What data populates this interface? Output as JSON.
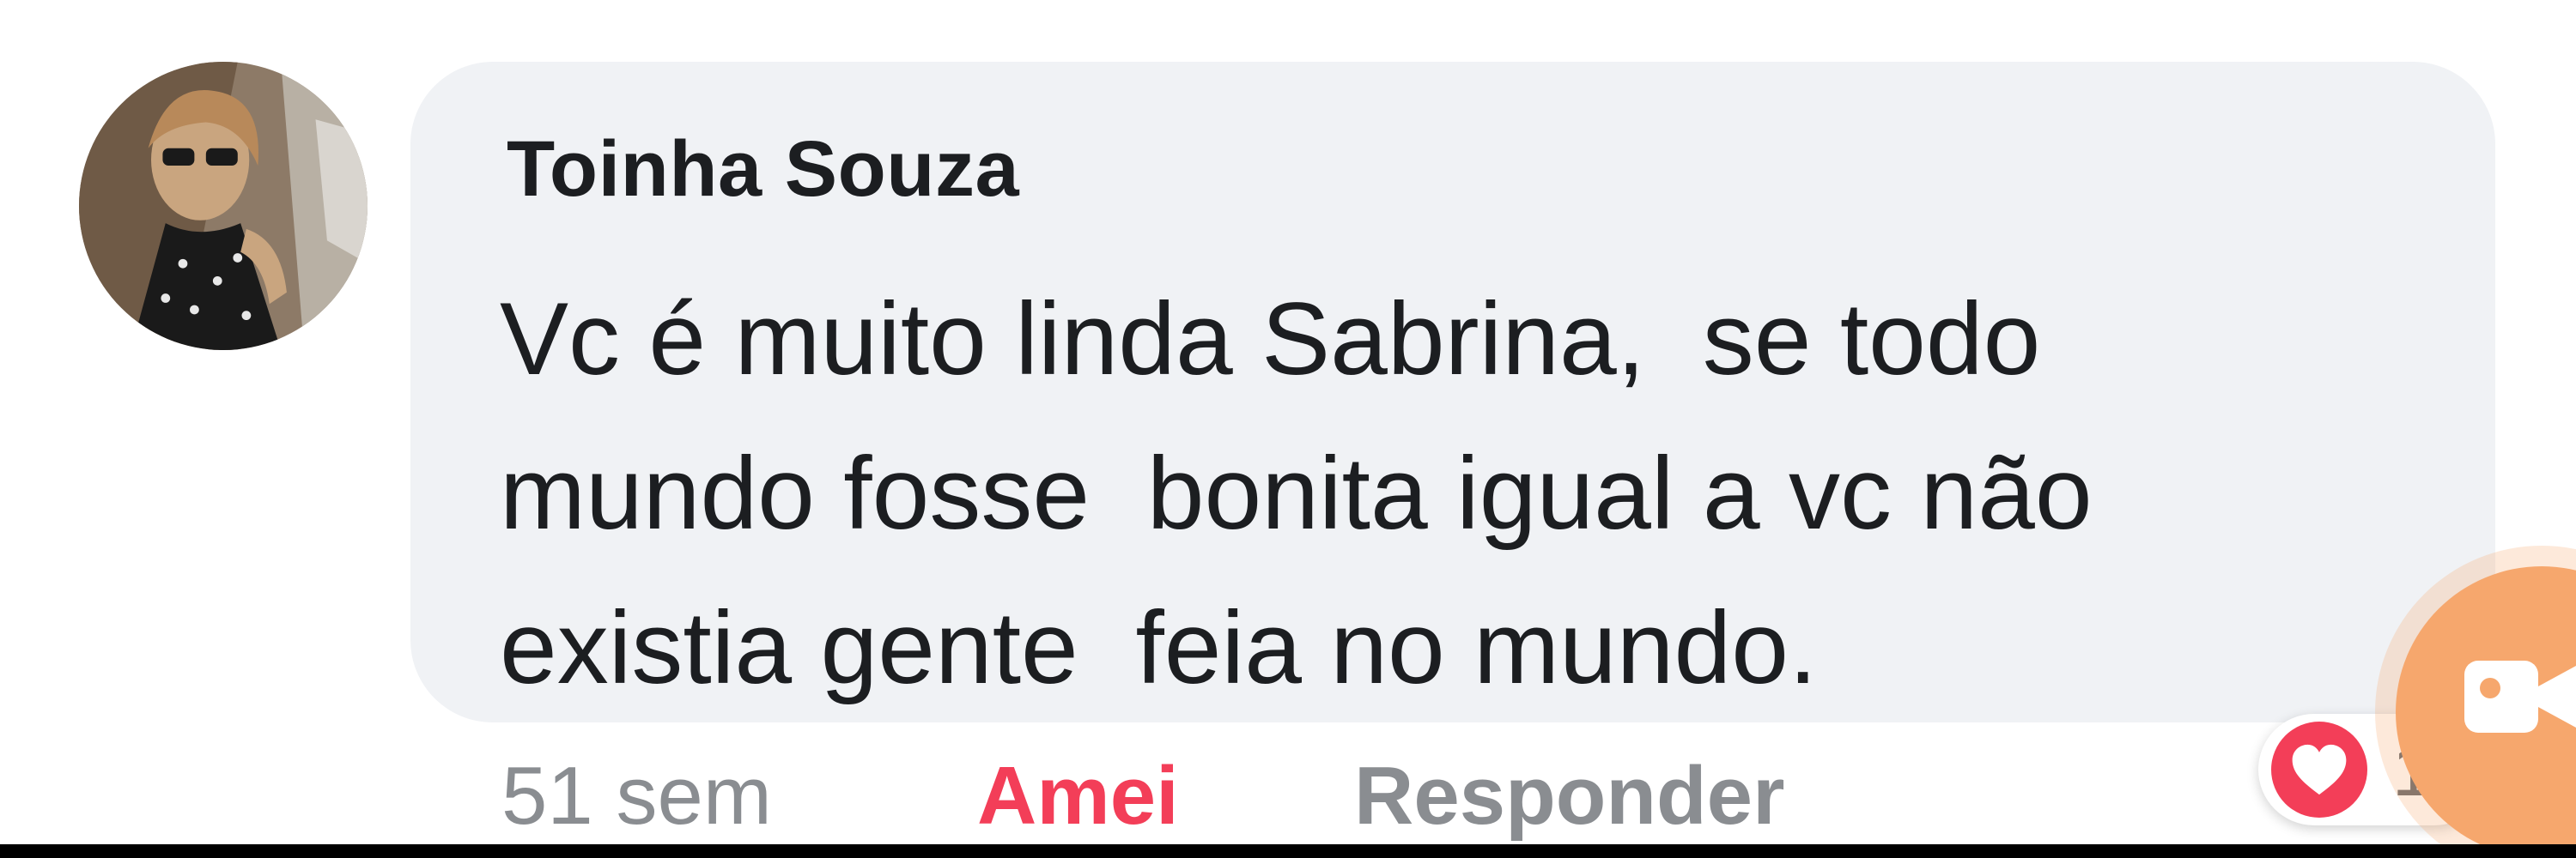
{
  "comment": {
    "author": "Toinha Souza",
    "text": "Vc é muito linda Sabrina,  se todo\nmundo fosse  bonita igual a vc não\nexistia gente  feia no mundo.",
    "time": "51 sem",
    "like_label": "Amei",
    "reply_label": "Responder",
    "reaction_count": "1"
  },
  "icons": {
    "reaction": "heart-icon",
    "floating_button": "video-camera-icon"
  },
  "colors": {
    "bubble": "#f0f2f5",
    "love": "#f33e58",
    "muted": "#8a8d91",
    "floating": "#f6a76d"
  }
}
